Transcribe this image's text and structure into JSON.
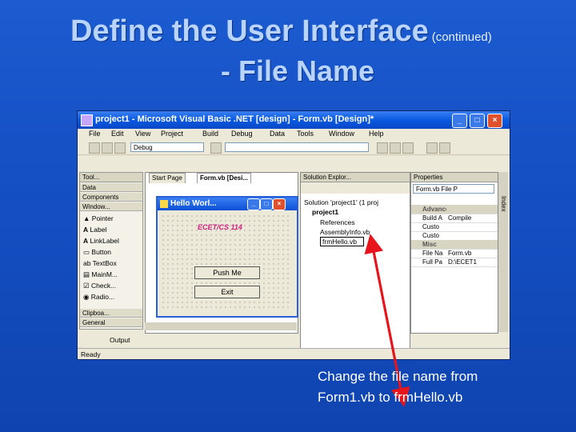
{
  "slide": {
    "title": "Define the User Interface",
    "title_suffix": "(continued)",
    "subtitle": "- File Name",
    "note_line1": "Change the file name from",
    "note_line2": "Form1.vb to frmHello.vb",
    "background_color": "#1550c4",
    "title_color": "#b8d4ff",
    "arrow_color": "#e8141c"
  },
  "ide": {
    "window_title": "project1 - Microsoft Visual Basic .NET [design] - Form.vb [Design]*",
    "menu": [
      "File",
      "Edit",
      "View",
      "Project",
      "Build",
      "Debug",
      "Data",
      "Tools",
      "Window",
      "Help"
    ],
    "config_combo": "Debug",
    "toolbox": {
      "header": "Tool...",
      "sections": [
        "Data",
        "Components",
        "Window..."
      ],
      "items": [
        "Pointer",
        "Label",
        "LinkLabel",
        "Button",
        "TextBox",
        "MainM...",
        "Check...",
        "Radio..."
      ],
      "footer_sections": [
        "Clipboa...",
        "General"
      ]
    },
    "tabs": [
      "Start Page",
      "Form.vb [Desi..."
    ],
    "form": {
      "title": "Hello Worl...",
      "label": "ECET/CS 114",
      "button1": "Push Me",
      "button2": "Exit"
    },
    "solution_explorer": {
      "header": "Solution Explor...",
      "solution": "Solution 'project1' (1 proj",
      "project": "project1",
      "references": "References",
      "assembly": "AssemblyInfo.vb",
      "file": "frmHello.vb"
    },
    "properties": {
      "header": "Properties",
      "object": "Form.vb  File P",
      "categories": [
        "Advanced",
        "Misc"
      ],
      "rows": [
        {
          "k": "Build A",
          "v": "Compile"
        },
        {
          "k": "Custo",
          "v": ""
        },
        {
          "k": "Custo",
          "v": ""
        },
        {
          "k": "File Na",
          "v": "Form.vb"
        },
        {
          "k": "Full Pa",
          "v": "D:\\ECET1"
        }
      ]
    },
    "side_label": "Index",
    "output_label": "Output",
    "status": "Ready"
  }
}
